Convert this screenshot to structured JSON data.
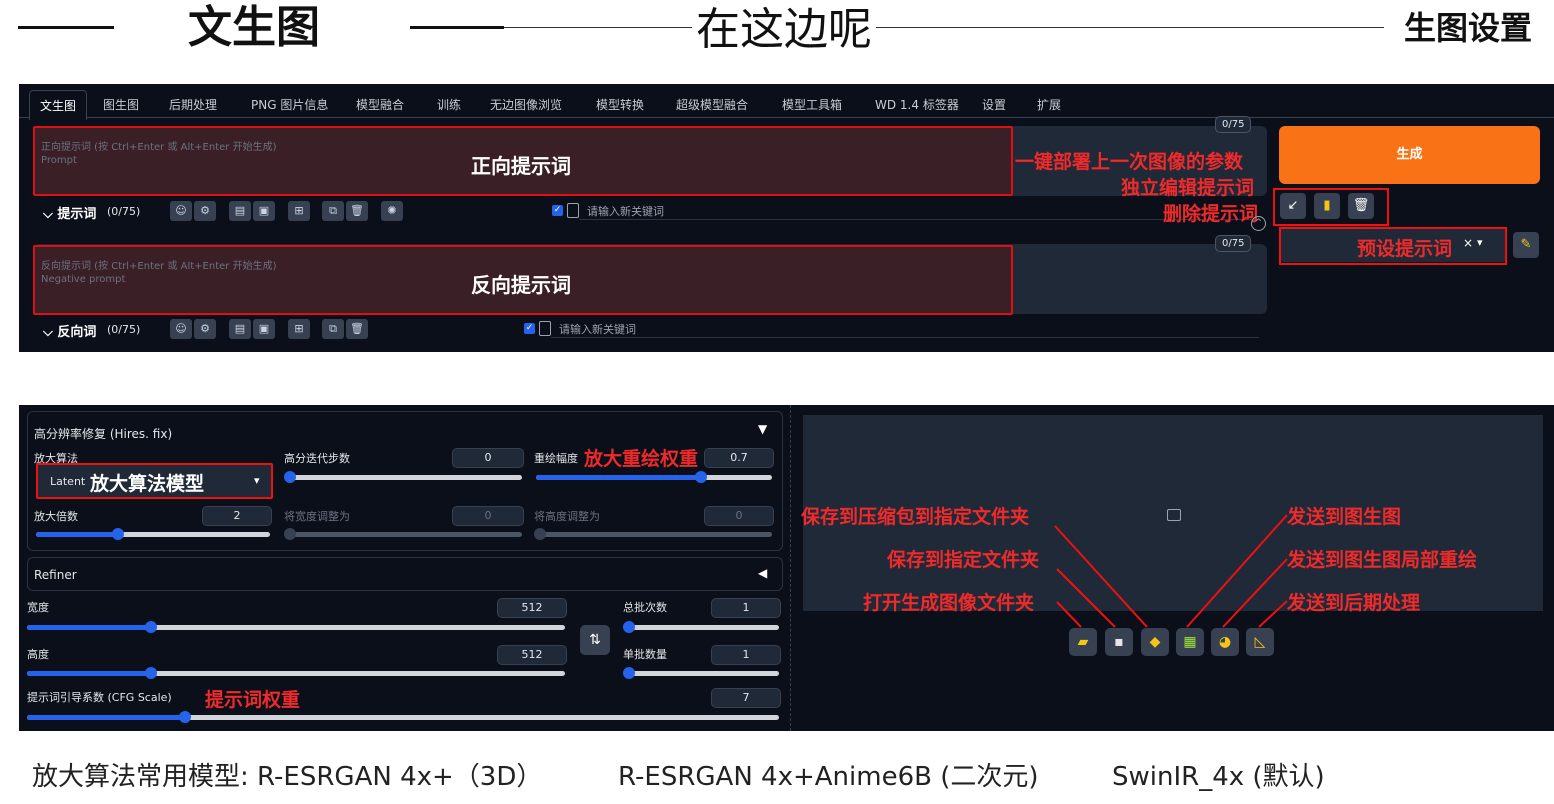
{
  "header": {
    "main_title": "文生图",
    "center_title": "在这边呢",
    "right_title": "生图设置"
  },
  "tabs": [
    "文生图",
    "图生图",
    "后期处理",
    "PNG 图片信息",
    "模型融合",
    "训练",
    "无边图像浏览",
    "模型转换",
    "超级模型融合",
    "模型工具箱",
    "WD 1.4 标签器",
    "设置",
    "扩展"
  ],
  "prompt": {
    "hint": "正向提示词 (按 Ctrl+Enter 或 Alt+Enter 开始生成)",
    "placeholder": "Prompt",
    "annotation": "正向提示词",
    "counter": "0/75",
    "row_label": "提示词",
    "row_count": "(0/75)",
    "keyword_placeholder": "请输入新关键词"
  },
  "negative": {
    "hint": "反向提示词 (按 Ctrl+Enter 或 Alt+Enter 开始生成)",
    "placeholder": "Negative prompt",
    "annotation": "反向提示词",
    "counter": "0/75",
    "row_label": "反向词",
    "row_count": "(0/75)",
    "keyword_placeholder": "请输入新关键词"
  },
  "generate_label": "生成",
  "annotations": {
    "read_params": "一键部署上一次图像的参数",
    "edit_prompt": "独立编辑提示词",
    "delete_prompt": "删除提示词",
    "preset": "预设提示词",
    "upscaler_model": "放大算法模型",
    "denoise": "放大重绘权重",
    "cfg": "提示词权重",
    "save_zip": "保存到压缩包到指定文件夹",
    "save_folder": "保存到指定文件夹",
    "open_folder": "打开生成图像文件夹",
    "send_img2img": "发送到图生图",
    "send_inpaint": "发送到图生图局部重绘",
    "send_extras": "发送到后期处理"
  },
  "hires": {
    "title": "高分辨率修复 (Hires. fix)",
    "upscaler_label": "放大算法",
    "upscaler_value": "Latent",
    "steps_label": "高分迭代步数",
    "steps_value": "0",
    "denoise_label": "重绘幅度",
    "denoise_value": "0.7",
    "scale_label": "放大倍数",
    "scale_value": "2",
    "resize_w_label": "将宽度调整为",
    "resize_w_value": "0",
    "resize_h_label": "将高度调整为",
    "resize_h_value": "0",
    "sliders": {
      "steps": 0.0,
      "denoise": 0.7,
      "scale": 0.35,
      "resize_w": 0.0,
      "resize_h": 0.0
    }
  },
  "refiner": {
    "title": "Refiner"
  },
  "size": {
    "width_label": "宽度",
    "width_value": "512",
    "height_label": "高度",
    "height_value": "512",
    "batch_count_label": "总批次数",
    "batch_count_value": "1",
    "batch_size_label": "单批数量",
    "batch_size_value": "1",
    "cfg_label": "提示词引导系数 (CFG Scale)",
    "cfg_value": "7",
    "swap_icon": "⇅",
    "sliders": {
      "width": 0.23,
      "height": 0.23,
      "batch_count": 0.0,
      "batch_size": 0.0,
      "cfg": 0.21
    }
  },
  "captions": [
    "放大算法常用模型: R-ESRGAN 4x+（3D）",
    "R-ESRGAN 4x+Anime6B (二次元)",
    "SwinIR_4x (默认)"
  ],
  "colors": {
    "panel": "#0b0f19",
    "accent": "#f97316",
    "annotation": "#ef2a2a",
    "slider": "#2563eb"
  }
}
